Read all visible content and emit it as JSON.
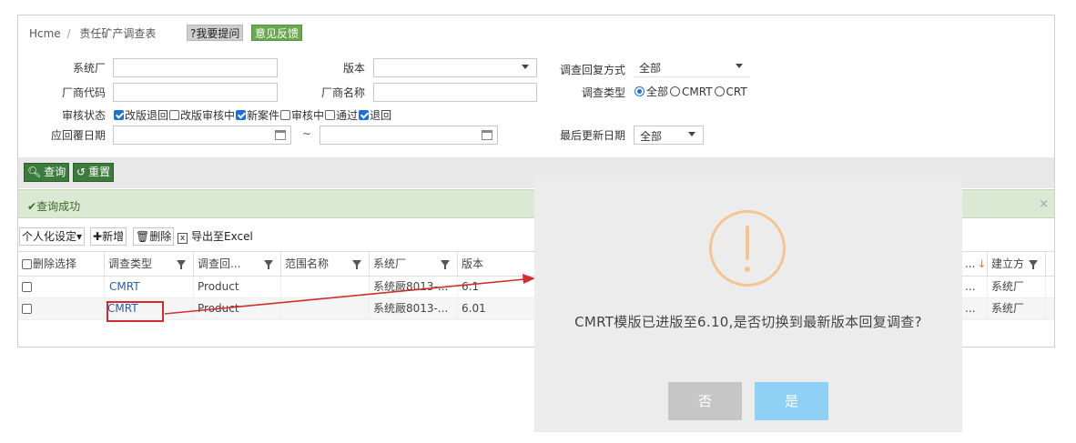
{
  "breadcrumb": {
    "home": "Hcme",
    "separator": "/",
    "current": "责任矿产调查表"
  },
  "header_buttons": {
    "help": "?我要提问",
    "feedback": "意见反馈"
  },
  "form": {
    "supplier_label": "系统厂",
    "supplier_value": "",
    "version_label": "版本",
    "version_value": "",
    "reply_mode_label": "调查回复方式",
    "reply_mode_value": "全部",
    "factory_code_label": "厂商代码",
    "factory_code_value": "",
    "factory_name_label": "厂商名称",
    "factory_name_value": "",
    "survey_type_label": "调查类型",
    "survey_type_options": [
      "全部",
      "CMRT",
      "CRT"
    ],
    "survey_type_selected": "全部",
    "status_label": "审核状态",
    "status_options": [
      {
        "label": "改版退回",
        "checked": true
      },
      {
        "label": "改版审核中",
        "checked": false
      },
      {
        "label": "新案件",
        "checked": true
      },
      {
        "label": "审核中",
        "checked": false
      },
      {
        "label": "通过",
        "checked": false
      },
      {
        "label": "退回",
        "checked": true
      }
    ],
    "reply_date_label": "应回覆日期",
    "reply_date_from": "",
    "reply_date_sep": "~",
    "reply_date_to": "",
    "last_update_label": "最后更新日期",
    "last_update_value": "全部"
  },
  "actions": {
    "search": "查询",
    "reset": "重置"
  },
  "banner": {
    "text": "查询成功",
    "close": "×"
  },
  "toolbar": {
    "personalize": "个人化设定",
    "add": "新增",
    "delete": "删除",
    "export": "导出至Excel"
  },
  "table": {
    "headers": [
      "删除选择",
      "调查类型",
      "调查回...",
      "范围名称",
      "系统厂",
      "版本",
      "...",
      "建立方"
    ],
    "rows": [
      {
        "type": "CMRT",
        "scope": "Product",
        "range": "",
        "supplier": "系统厰8013-...",
        "version": "6.1",
        "misc": "...",
        "creator": "系统厂"
      },
      {
        "type": "CMRT",
        "scope": "Product",
        "range": "",
        "supplier": "系统厰8013-...",
        "version": "6.01",
        "misc": "...",
        "creator": "系统厂"
      }
    ]
  },
  "modal": {
    "message": "CMRT模版已进版至6.10,是否切换到最新版本回复调查?",
    "no": "否",
    "yes": "是"
  },
  "colors": {
    "accent_green": "#3d7a3d",
    "banner_bg": "#dbe8d3",
    "warning": "#f5c591",
    "confirm": "#8fd1f5",
    "annotation_red": "#d42c2c"
  }
}
